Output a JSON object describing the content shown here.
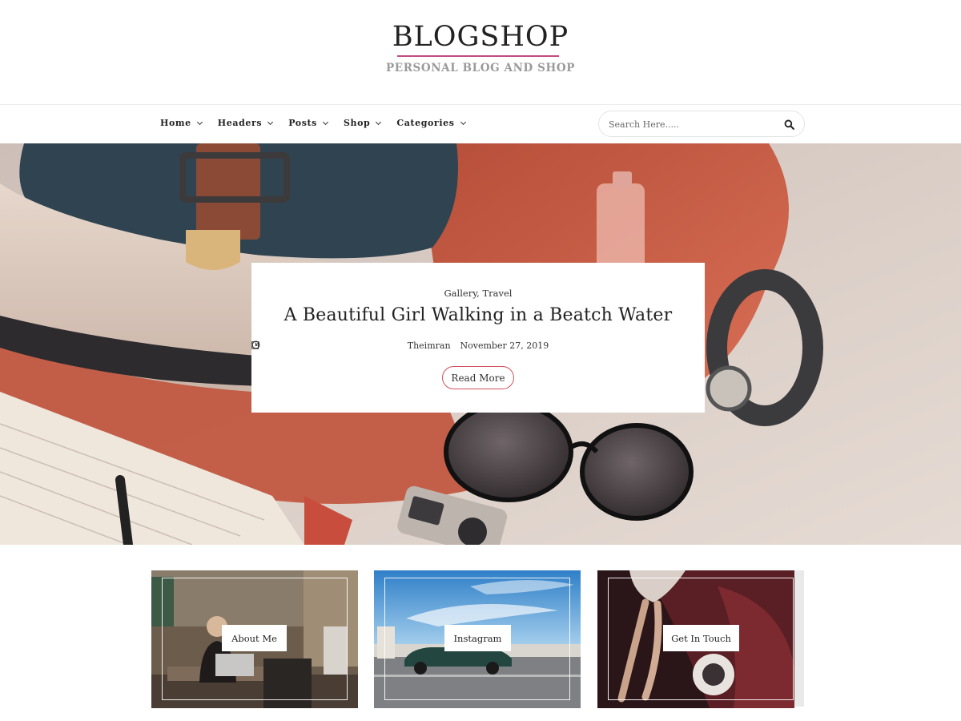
{
  "site": {
    "title": "BLOGSHOP",
    "tagline": "PERSONAL BLOG AND SHOP",
    "accent_color": "#c14a83"
  },
  "nav": {
    "items": [
      {
        "label": "Home",
        "icon": "chevron-down-icon"
      },
      {
        "label": "Headers",
        "icon": "chevron-down-icon"
      },
      {
        "label": "Posts",
        "icon": "chevron-down-icon"
      },
      {
        "label": "Shop",
        "icon": "chevron-down-icon"
      },
      {
        "label": "Categories",
        "icon": "chevron-down-icon"
      }
    ]
  },
  "search": {
    "placeholder": "Search Here.....",
    "value": "",
    "icon": "search-icon"
  },
  "hero": {
    "categories": "Gallery, Travel",
    "title": "A Beautiful Girl Walking in a Beatch Water",
    "author": "Theimran",
    "author_icon": "edit-icon",
    "date": "November 27, 2019",
    "date_icon": "clock-icon",
    "button_label": "Read More",
    "button_border_color": "#d2515e"
  },
  "promos": [
    {
      "label": "About Me"
    },
    {
      "label": "Instagram"
    },
    {
      "label": "Get In Touch"
    }
  ]
}
